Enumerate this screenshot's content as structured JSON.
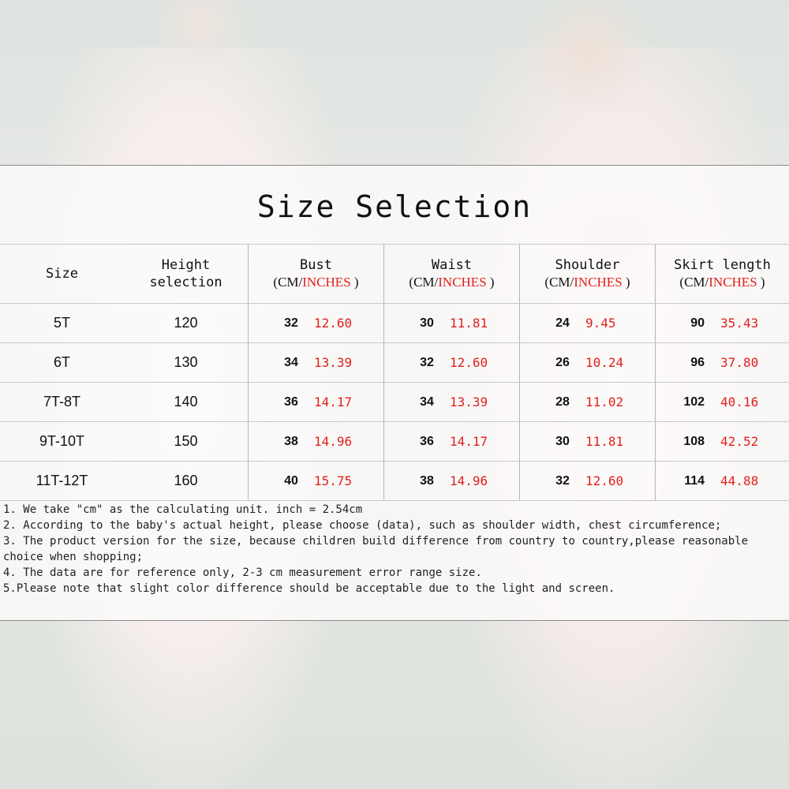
{
  "title": "Size Selection",
  "headers": {
    "size": "Size",
    "height_line1": "Height",
    "height_line2": "selection",
    "bust": "Bust",
    "waist": "Waist",
    "shoulder": "Shoulder",
    "skirt": "Skirt length",
    "unit_open": "(CM/",
    "unit_inches": "INCHES",
    "unit_close": " )"
  },
  "rows": [
    {
      "size": "5T",
      "height": "120",
      "bust_cm": "32",
      "bust_in": "12.60",
      "waist_cm": "30",
      "waist_in": "11.81",
      "shoulder_cm": "24",
      "shoulder_in": "9.45",
      "skirt_cm": "90",
      "skirt_in": "35.43"
    },
    {
      "size": "6T",
      "height": "130",
      "bust_cm": "34",
      "bust_in": "13.39",
      "waist_cm": "32",
      "waist_in": "12.60",
      "shoulder_cm": "26",
      "shoulder_in": "10.24",
      "skirt_cm": "96",
      "skirt_in": "37.80"
    },
    {
      "size": "7T-8T",
      "height": "140",
      "bust_cm": "36",
      "bust_in": "14.17",
      "waist_cm": "34",
      "waist_in": "13.39",
      "shoulder_cm": "28",
      "shoulder_in": "11.02",
      "skirt_cm": "102",
      "skirt_in": "40.16"
    },
    {
      "size": "9T-10T",
      "height": "150",
      "bust_cm": "38",
      "bust_in": "14.96",
      "waist_cm": "36",
      "waist_in": "14.17",
      "shoulder_cm": "30",
      "shoulder_in": "11.81",
      "skirt_cm": "108",
      "skirt_in": "42.52"
    },
    {
      "size": "11T-12T",
      "height": "160",
      "bust_cm": "40",
      "bust_in": "15.75",
      "waist_cm": "38",
      "waist_in": "14.96",
      "shoulder_cm": "32",
      "shoulder_in": "12.60",
      "skirt_cm": "114",
      "skirt_in": "44.88"
    }
  ],
  "notes": [
    "1. We take \"cm\" as the calculating unit. inch = 2.54cm",
    "2. According to the baby's actual height, please choose (data), such as shoulder width, chest circumference;",
    "3. The product version for the size, because children build difference from country to country,please reasonable choice when shopping;",
    "4. The data are for reference only, 2-3 cm measurement error range size.",
    "5.Please note that slight color difference should be acceptable due to the light and screen."
  ],
  "colors": {
    "inch_text": "#e0201c",
    "text": "#111111"
  }
}
